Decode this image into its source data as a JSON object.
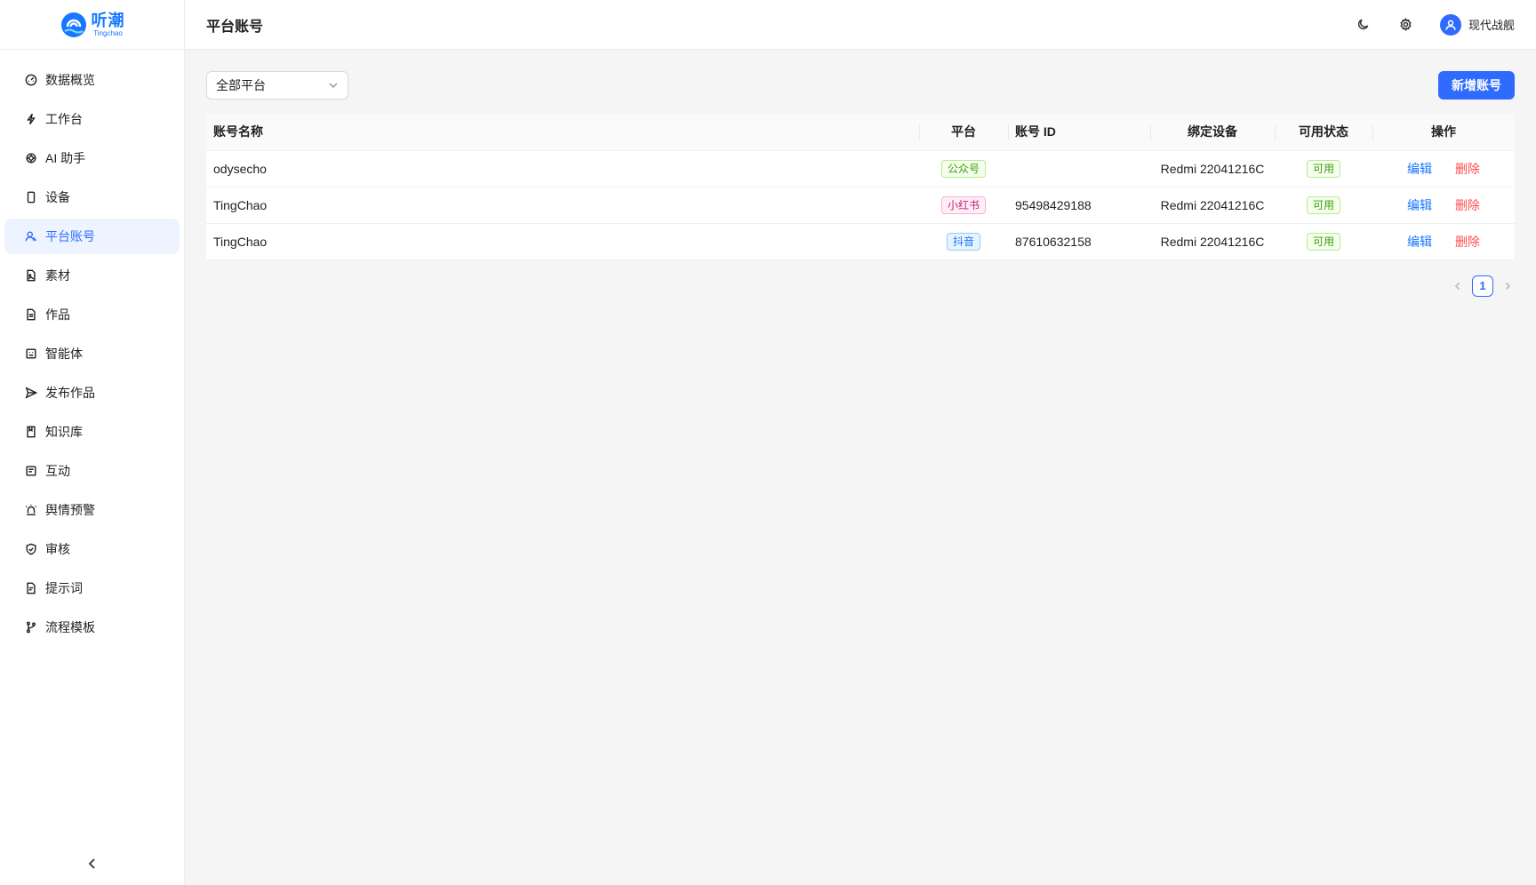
{
  "brand": {
    "name_cn": "听潮",
    "name_en": "Tingchao",
    "color": "#1677ff"
  },
  "header": {
    "title": "平台账号",
    "user_name": "现代战舰"
  },
  "sidebar": {
    "items": [
      {
        "label": "数据概览",
        "icon": "dashboard-icon"
      },
      {
        "label": "工作台",
        "icon": "lightning-icon"
      },
      {
        "label": "AI 助手",
        "icon": "openai-icon"
      },
      {
        "label": "设备",
        "icon": "phone-icon"
      },
      {
        "label": "平台账号",
        "icon": "user-accounts-icon",
        "active": true
      },
      {
        "label": "素材",
        "icon": "file-image-icon"
      },
      {
        "label": "作品",
        "icon": "file-text-icon"
      },
      {
        "label": "智能体",
        "icon": "bot-icon"
      },
      {
        "label": "发布作品",
        "icon": "send-icon"
      },
      {
        "label": "知识库",
        "icon": "book-icon"
      },
      {
        "label": "互动",
        "icon": "message-square-icon"
      },
      {
        "label": "舆情预警",
        "icon": "siren-icon"
      },
      {
        "label": "审核",
        "icon": "shield-check-icon"
      },
      {
        "label": "提示词",
        "icon": "file-prompt-icon"
      },
      {
        "label": "流程模板",
        "icon": "git-branch-icon"
      }
    ]
  },
  "toolbar": {
    "filter_value": "全部平台",
    "add_button": "新增账号"
  },
  "table": {
    "columns": [
      "账号名称",
      "平台",
      "账号 ID",
      "绑定设备",
      "可用状态",
      "操作"
    ],
    "rows": [
      {
        "name": "odysecho",
        "platform": "公众号",
        "platform_color": "green",
        "account_id": "",
        "device": "Redmi 22041216C",
        "status": "可用",
        "edit": "编辑",
        "delete": "删除"
      },
      {
        "name": "TingChao",
        "platform": "小红书",
        "platform_color": "pink",
        "account_id": "95498429188",
        "device": "Redmi 22041216C",
        "status": "可用",
        "edit": "编辑",
        "delete": "删除"
      },
      {
        "name": "TingChao",
        "platform": "抖音",
        "platform_color": "blue",
        "account_id": "87610632158",
        "device": "Redmi 22041216C",
        "status": "可用",
        "edit": "编辑",
        "delete": "删除"
      }
    ]
  },
  "pagination": {
    "current_page": "1"
  },
  "colors": {
    "primary": "#2f6bff",
    "danger": "#ff4d4f",
    "success": "#389e0d"
  }
}
